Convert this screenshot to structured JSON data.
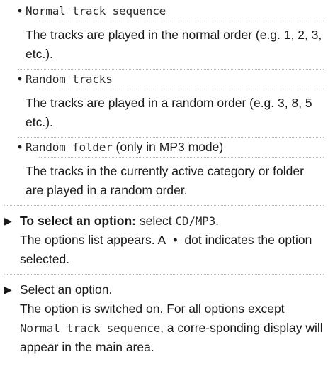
{
  "bullets": [
    {
      "option": "Normal track sequence",
      "note": "",
      "description": "The tracks are played in the normal order (e.g. 1, 2, 3, etc.)."
    },
    {
      "option": "Random tracks",
      "note": "",
      "description": "The tracks are played in a random order (e.g. 3, 8, 5 etc.)."
    },
    {
      "option": "Random folder",
      "note": " (only in MP3 mode)",
      "description": "The tracks in the currently active category or folder are played in a random order."
    }
  ],
  "step1": {
    "bold": "To select an option:",
    "text": " select ",
    "menu": "CD/MP3",
    "period": ".",
    "line2_a": "The options list appears. A",
    "dot": "•",
    "line2_b": "dot indicates the option selected."
  },
  "step2": {
    "text": "Select an option.",
    "line2_a": "The option is switched on. For all options except ",
    "menu": "Normal track sequence",
    "line2_b": ", a corre-sponding display will appear in the main area."
  },
  "glyphs": {
    "bullet": "•",
    "arrow": "▶"
  }
}
